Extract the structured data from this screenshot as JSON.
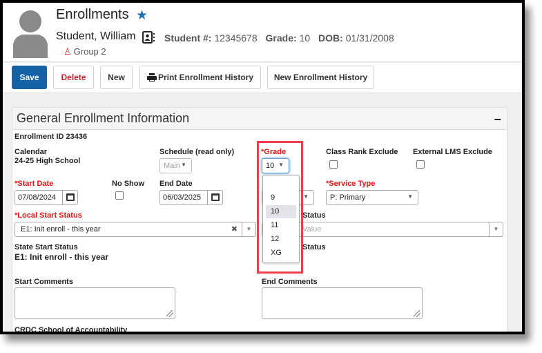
{
  "header": {
    "title": "Enrollments",
    "favorite_icon": "star-icon",
    "student_name": "Student, William",
    "student_card_icon": "contact-card-icon",
    "student_number_label": "Student #:",
    "student_number": "12345678",
    "grade_label": "Grade:",
    "grade": "10",
    "dob_label": "DOB:",
    "dob": "01/31/2008",
    "group_icon": "person-pin-icon",
    "group": "Group 2"
  },
  "toolbar": {
    "save_label": "Save",
    "delete_label": "Delete",
    "new_label": "New",
    "print_label": "Print Enrollment History",
    "new_history_label": "New Enrollment History"
  },
  "panel": {
    "title": "General Enrollment Information",
    "collapse_label": "−",
    "enrollment_id": "Enrollment ID 23436",
    "calendar_label": "Calendar",
    "calendar_value": "24-25 High School",
    "schedule_label": "Schedule (read only)",
    "schedule_value": "Main",
    "grade_label": "*Grade",
    "grade_value": "10",
    "grade_options": [
      "",
      "9",
      "10",
      "11",
      "12",
      "XG"
    ],
    "grade_selected": "10",
    "class_rank_label": "Class Rank Exclude",
    "external_lms_label": "External LMS Exclude",
    "start_date_label": "*Start Date",
    "start_date_value": "07/08/2024",
    "no_show_label": "No Show",
    "end_date_label": "End Date",
    "end_date_value": "06/03/2025",
    "service_type_label": "*Service Type",
    "service_type_value": "P: Primary",
    "local_start_status_label": "*Local Start Status",
    "local_start_status_value": "E1: Init enroll - this year",
    "local_end_status_label_partial": "Status",
    "local_end_status_placeholder": "Value",
    "state_start_status_label": "State Start Status",
    "state_start_status_value": "E1: Init enroll - this year",
    "state_end_status_label_partial": "Status",
    "start_comments_label": "Start Comments",
    "end_comments_label": "End Comments",
    "crdc_label": "CRDC School of Accountability"
  }
}
